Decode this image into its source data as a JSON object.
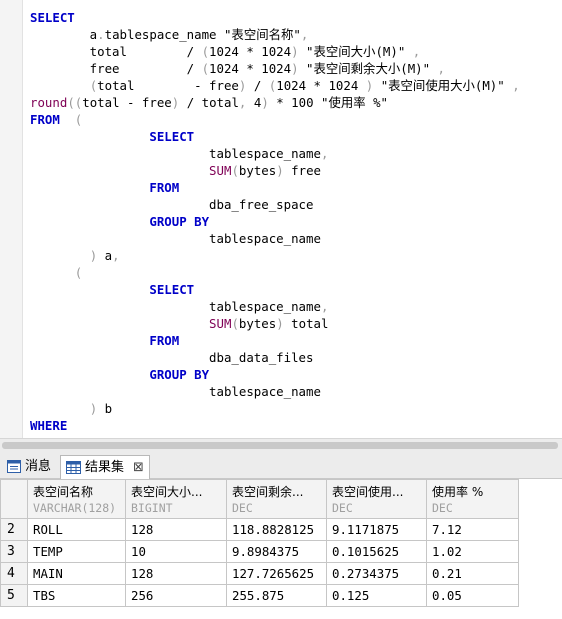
{
  "editor": {
    "sql": [
      [
        {
          "t": "SELECT",
          "c": "kw"
        }
      ],
      [
        {
          "t": "        a"
        },
        {
          "t": ".",
          "c": "sy"
        },
        {
          "t": "tablespace_name \"表空间名称\""
        },
        {
          "t": ",",
          "c": "sy"
        }
      ],
      [
        {
          "t": "        total        / "
        },
        {
          "t": "(",
          "c": "sy"
        },
        {
          "t": "1024 * 1024"
        },
        {
          "t": ")",
          "c": "sy"
        },
        {
          "t": " \"表空间大小(M)\" "
        },
        {
          "t": ",",
          "c": "sy"
        }
      ],
      [
        {
          "t": "        free         / "
        },
        {
          "t": "(",
          "c": "sy"
        },
        {
          "t": "1024 * 1024"
        },
        {
          "t": ")",
          "c": "sy"
        },
        {
          "t": " \"表空间剩余大小(M)\" "
        },
        {
          "t": ",",
          "c": "sy"
        }
      ],
      [
        {
          "t": "        "
        },
        {
          "t": "(",
          "c": "sy"
        },
        {
          "t": "total        - free"
        },
        {
          "t": ")",
          "c": "sy"
        },
        {
          "t": " / "
        },
        {
          "t": "(",
          "c": "sy"
        },
        {
          "t": "1024 * 1024 "
        },
        {
          "t": ")",
          "c": "sy"
        },
        {
          "t": " \"表空间使用大小(M)\" "
        },
        {
          "t": ",",
          "c": "sy"
        }
      ],
      [
        {
          "t": "round",
          "c": "fn"
        },
        {
          "t": "((",
          "c": "sy"
        },
        {
          "t": "total - free"
        },
        {
          "t": ")",
          "c": "sy"
        },
        {
          "t": " / total"
        },
        {
          "t": ",",
          "c": "sy"
        },
        {
          "t": " 4"
        },
        {
          "t": ")",
          "c": "sy"
        },
        {
          "t": " * 100 \"使用率 %\""
        }
      ],
      [
        {
          "t": "FROM",
          "c": "kw"
        },
        {
          "t": "  "
        },
        {
          "t": "(",
          "c": "sy"
        }
      ],
      [
        {
          "t": "                "
        },
        {
          "t": "SELECT",
          "c": "kw"
        }
      ],
      [
        {
          "t": "                        tablespace_name"
        },
        {
          "t": ",",
          "c": "sy"
        }
      ],
      [
        {
          "t": "                        "
        },
        {
          "t": "SUM",
          "c": "fn"
        },
        {
          "t": "(",
          "c": "sy"
        },
        {
          "t": "bytes"
        },
        {
          "t": ")",
          "c": "sy"
        },
        {
          "t": " free"
        }
      ],
      [
        {
          "t": "                "
        },
        {
          "t": "FROM",
          "c": "kw"
        }
      ],
      [
        {
          "t": "                        dba_free_space"
        }
      ],
      [
        {
          "t": "                "
        },
        {
          "t": "GROUP BY",
          "c": "kw"
        }
      ],
      [
        {
          "t": "                        tablespace_name"
        }
      ],
      [
        {
          "t": "        "
        },
        {
          "t": ")",
          "c": "sy"
        },
        {
          "t": " a"
        },
        {
          "t": ",",
          "c": "sy"
        }
      ],
      [
        {
          "t": "      "
        },
        {
          "t": "(",
          "c": "sy"
        }
      ],
      [
        {
          "t": "                "
        },
        {
          "t": "SELECT",
          "c": "kw"
        }
      ],
      [
        {
          "t": "                        tablespace_name"
        },
        {
          "t": ",",
          "c": "sy"
        }
      ],
      [
        {
          "t": "                        "
        },
        {
          "t": "SUM",
          "c": "fn"
        },
        {
          "t": "(",
          "c": "sy"
        },
        {
          "t": "bytes"
        },
        {
          "t": ")",
          "c": "sy"
        },
        {
          "t": " total"
        }
      ],
      [
        {
          "t": "                "
        },
        {
          "t": "FROM",
          "c": "kw"
        }
      ],
      [
        {
          "t": "                        dba_data_files"
        }
      ],
      [
        {
          "t": "                "
        },
        {
          "t": "GROUP BY",
          "c": "kw"
        }
      ],
      [
        {
          "t": "                        tablespace_name"
        }
      ],
      [
        {
          "t": "        "
        },
        {
          "t": ")",
          "c": "sy"
        },
        {
          "t": " b"
        }
      ],
      [
        {
          "t": "WHERE",
          "c": "kw"
        }
      ]
    ]
  },
  "tabs": {
    "messages_label": "消息",
    "results_label": "结果集",
    "close_glyph": "⊠"
  },
  "grid": {
    "columns": [
      {
        "name": "表空间名称",
        "type": "VARCHAR(128)"
      },
      {
        "name": "表空间大小...",
        "type": "BIGINT"
      },
      {
        "name": "表空间剩余...",
        "type": "DEC"
      },
      {
        "name": "表空间使用...",
        "type": "DEC"
      },
      {
        "name": "使用率 %",
        "type": "DEC"
      }
    ],
    "rows": [
      {
        "n": "2",
        "cells": [
          "ROLL",
          "128",
          "118.8828125",
          "9.1171875",
          "7.12"
        ]
      },
      {
        "n": "3",
        "cells": [
          "TEMP",
          "10",
          "9.8984375",
          "0.1015625",
          "1.02"
        ]
      },
      {
        "n": "4",
        "cells": [
          "MAIN",
          "128",
          "127.7265625",
          "0.2734375",
          "0.21"
        ]
      },
      {
        "n": "5",
        "cells": [
          "TBS",
          "256",
          "255.875",
          "0.125",
          "0.05"
        ]
      }
    ]
  }
}
